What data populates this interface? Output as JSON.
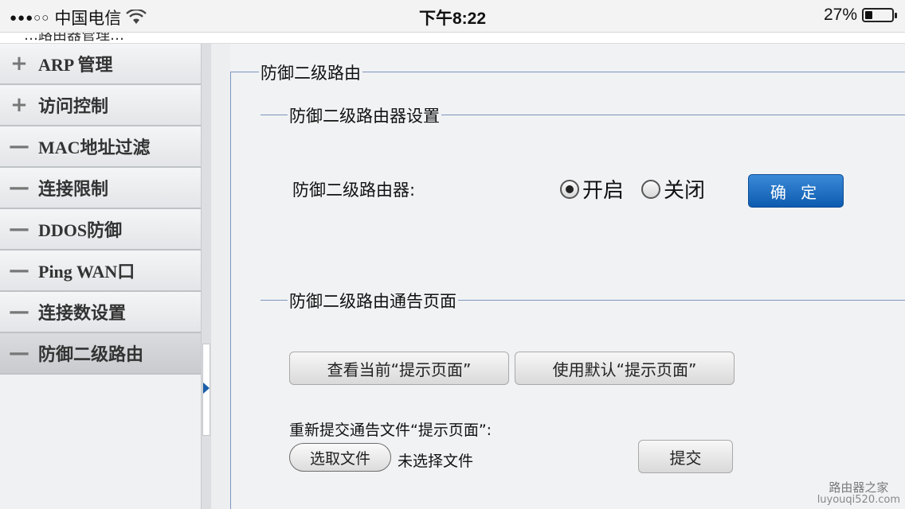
{
  "status_bar": {
    "signal": "●●●○○",
    "carrier": "中国电信",
    "time": "下午8:22",
    "battery_text": "27%",
    "battery_level": 0.27
  },
  "header": {
    "truncated_text": "…路由器管理…"
  },
  "sidebar": {
    "items": [
      {
        "icon": "+",
        "label": "ARP 管理"
      },
      {
        "icon": "+",
        "label": "访问控制"
      },
      {
        "icon": "—",
        "label": "MAC地址过滤"
      },
      {
        "icon": "—",
        "label": "连接限制"
      },
      {
        "icon": "—",
        "label": "DDOS防御"
      },
      {
        "icon": "—",
        "label": "Ping WAN口"
      },
      {
        "icon": "—",
        "label": "连接数设置"
      },
      {
        "icon": "—",
        "label": "防御二级路由"
      }
    ]
  },
  "main": {
    "section_title": "防御二级路由",
    "settings": {
      "legend": "防御二级路由器设置",
      "field_label": "防御二级路由器:",
      "options": [
        "开启",
        "关闭"
      ],
      "selected": "开启",
      "confirm_label": "确 定"
    },
    "notice": {
      "legend": "防御二级路由通告页面",
      "view_button": "查看当前“提示页面”",
      "default_button": "使用默认“提示页面”",
      "resubmit_label": "重新提交通告文件“提示页面”:",
      "choose_file_button": "选取文件",
      "no_file_text": "未选择文件",
      "submit_button": "提交"
    }
  },
  "watermark": {
    "title": "路由器之家",
    "url": "luyouqi520.com"
  },
  "colors": {
    "accent": "#0d5bb0",
    "frame": "#7b97bd"
  }
}
